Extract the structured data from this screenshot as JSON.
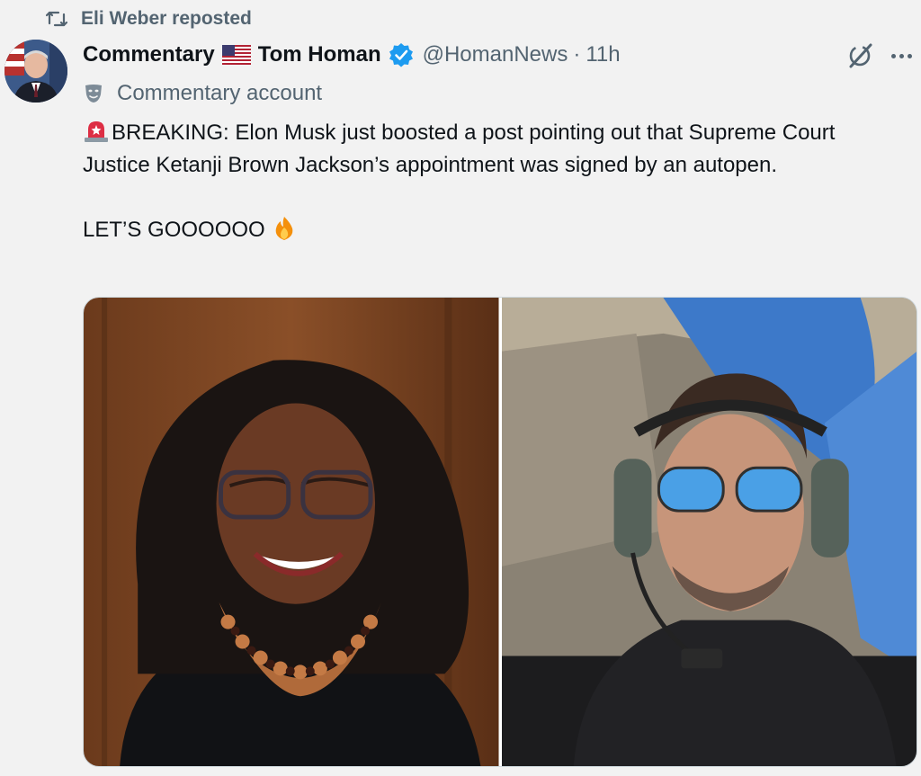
{
  "repost": {
    "label": "Eli Weber reposted",
    "icon": "repost-icon"
  },
  "author": {
    "display_name_prefix": "Commentary",
    "flag": "🇺🇸",
    "display_name": "Tom Homan",
    "handle": "@HomanNews",
    "separator": "·",
    "time": "11h",
    "verified": true,
    "account_label": "Commentary account"
  },
  "tweet": {
    "line1": "BREAKING: Elon Musk just boosted a post pointing out that Supreme Court Justice Ketanji Brown Jackson’s appointment was signed by an autopen.",
    "line2": "LET’S GOOOOOO",
    "emoji_start": "🚨",
    "emoji_end": "🔥"
  },
  "media": [
    {
      "alt_icon": "portrait-photo"
    },
    {
      "alt_icon": "cockpit-photo"
    }
  ],
  "colors": {
    "background": "#f2f2f2",
    "text_primary": "#0f1419",
    "text_secondary": "#536471",
    "verified_blue": "#1d9bf0"
  }
}
